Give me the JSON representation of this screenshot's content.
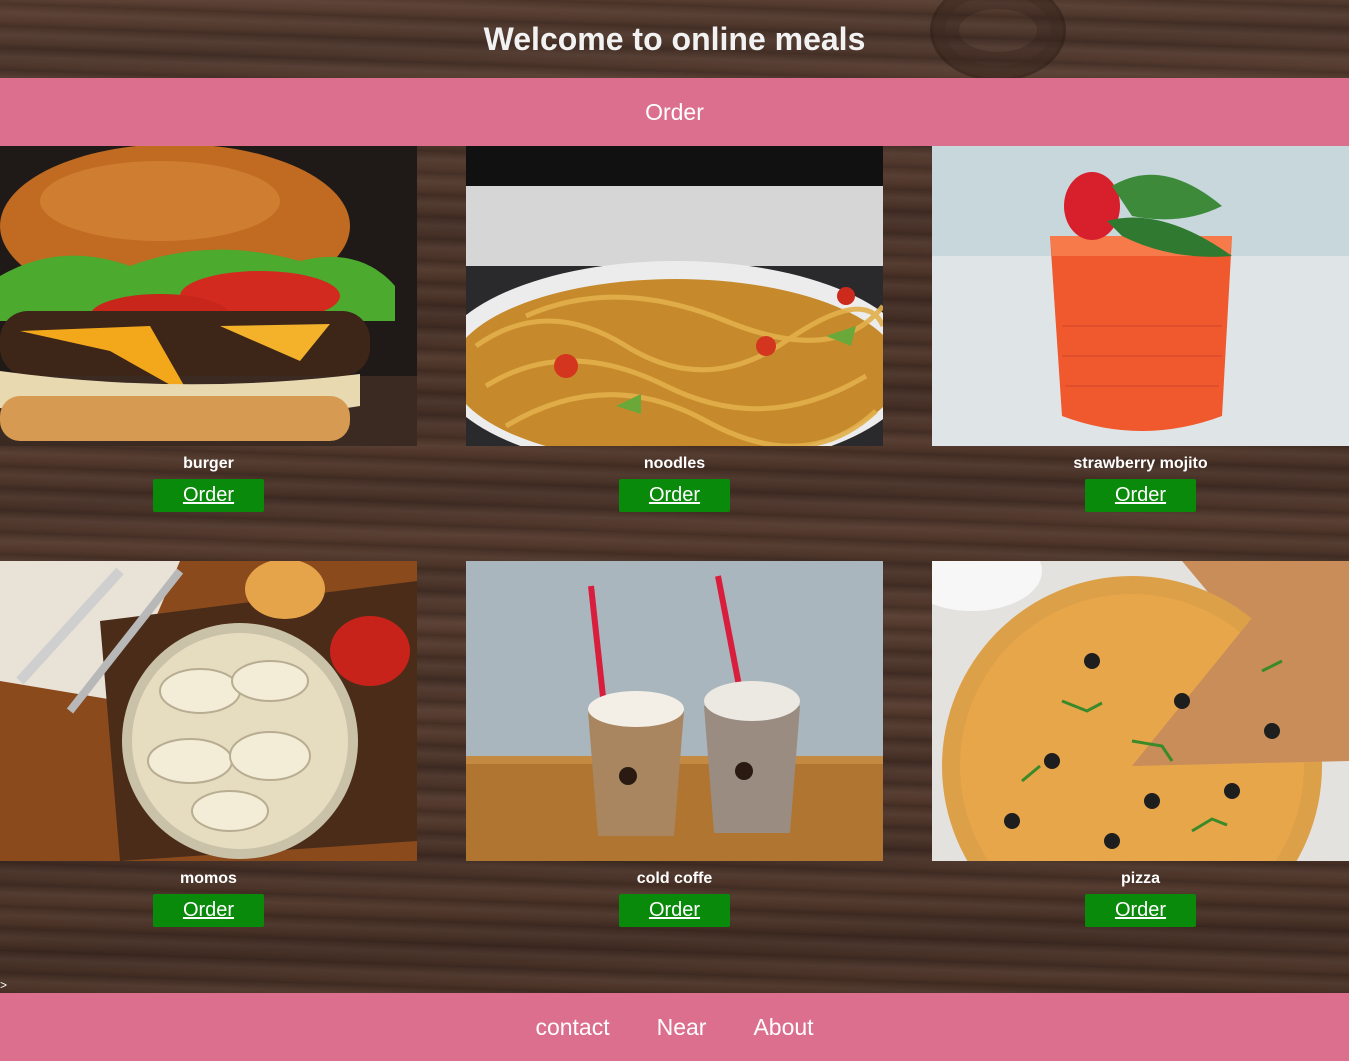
{
  "header": {
    "title": "Welcome to online meals"
  },
  "nav": {
    "order_link": "Order"
  },
  "items": [
    {
      "name": "burger",
      "button": "Order"
    },
    {
      "name": "noodles",
      "button": "Order"
    },
    {
      "name": "strawberry mojito",
      "button": "Order"
    },
    {
      "name": "momos",
      "button": "Order"
    },
    {
      "name": "cold coffe",
      "button": "Order"
    },
    {
      "name": "pizza",
      "button": "Order"
    }
  ],
  "stray_text": ">",
  "footer": {
    "links": [
      "contact",
      "Near",
      "About"
    ]
  },
  "colors": {
    "bar": "#dc6f8e",
    "button": "#0a8a0a"
  }
}
